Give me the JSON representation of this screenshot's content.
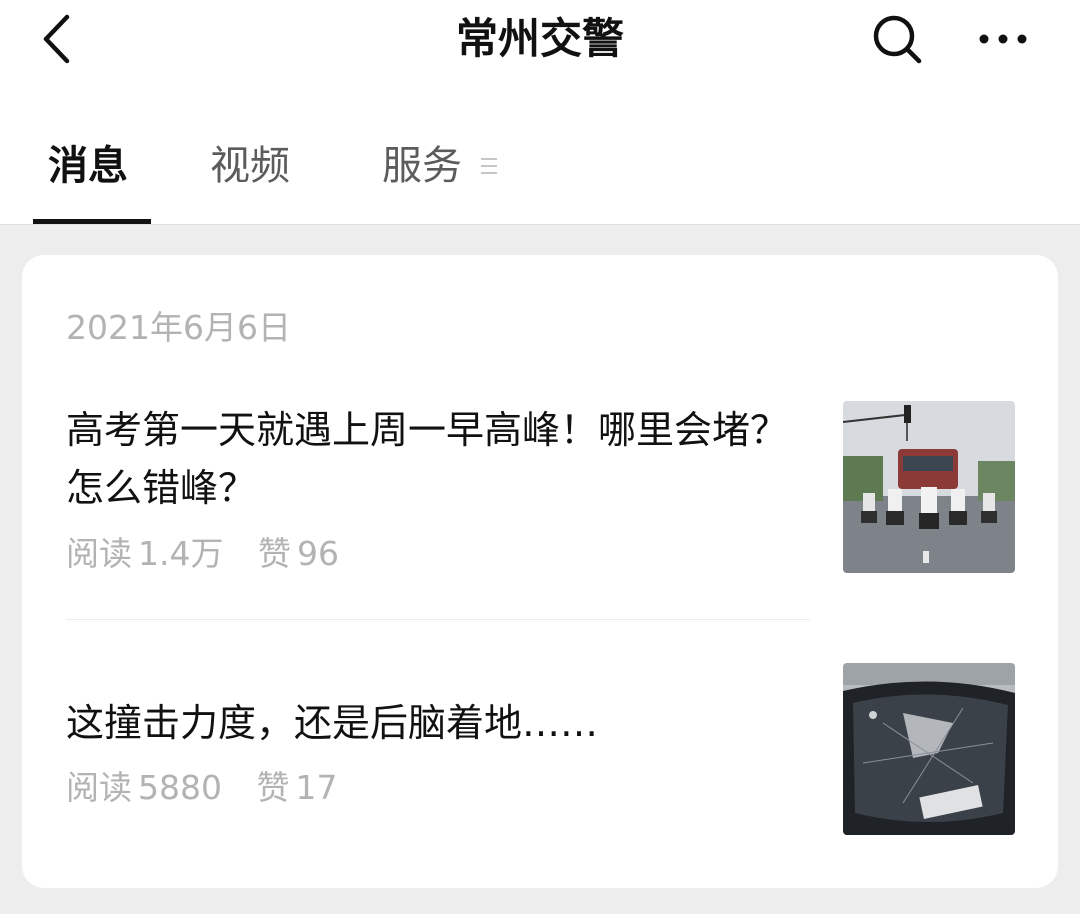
{
  "header": {
    "title": "常州交警",
    "back_icon": "chevron-left-icon",
    "search_icon": "search-icon",
    "more_icon": "more-horizontal-icon"
  },
  "tabs": [
    {
      "label": "消息",
      "active": true
    },
    {
      "label": "视频",
      "active": false
    },
    {
      "label": "服务",
      "active": false,
      "has_menu": true
    }
  ],
  "feed": {
    "date": "2021年6月6日",
    "articles": [
      {
        "title": "高考第一天就遇上周一早高峰！哪里会堵？怎么错峰？",
        "read_label": "阅读",
        "read_count": "1.4万",
        "like_label": "赞",
        "like_count": "96",
        "thumbnail": "police-motorcycle-escort-photo"
      },
      {
        "title": "这撞击力度，还是后脑着地……",
        "read_label": "阅读",
        "read_count": "5880",
        "like_label": "赞",
        "like_count": "17",
        "thumbnail": "cracked-windshield-photo"
      }
    ]
  },
  "colors": {
    "background": "#ededed",
    "card": "#ffffff",
    "text_primary": "#111111",
    "text_secondary": "#b3b3b3",
    "tab_inactive": "#5c5c5c"
  }
}
